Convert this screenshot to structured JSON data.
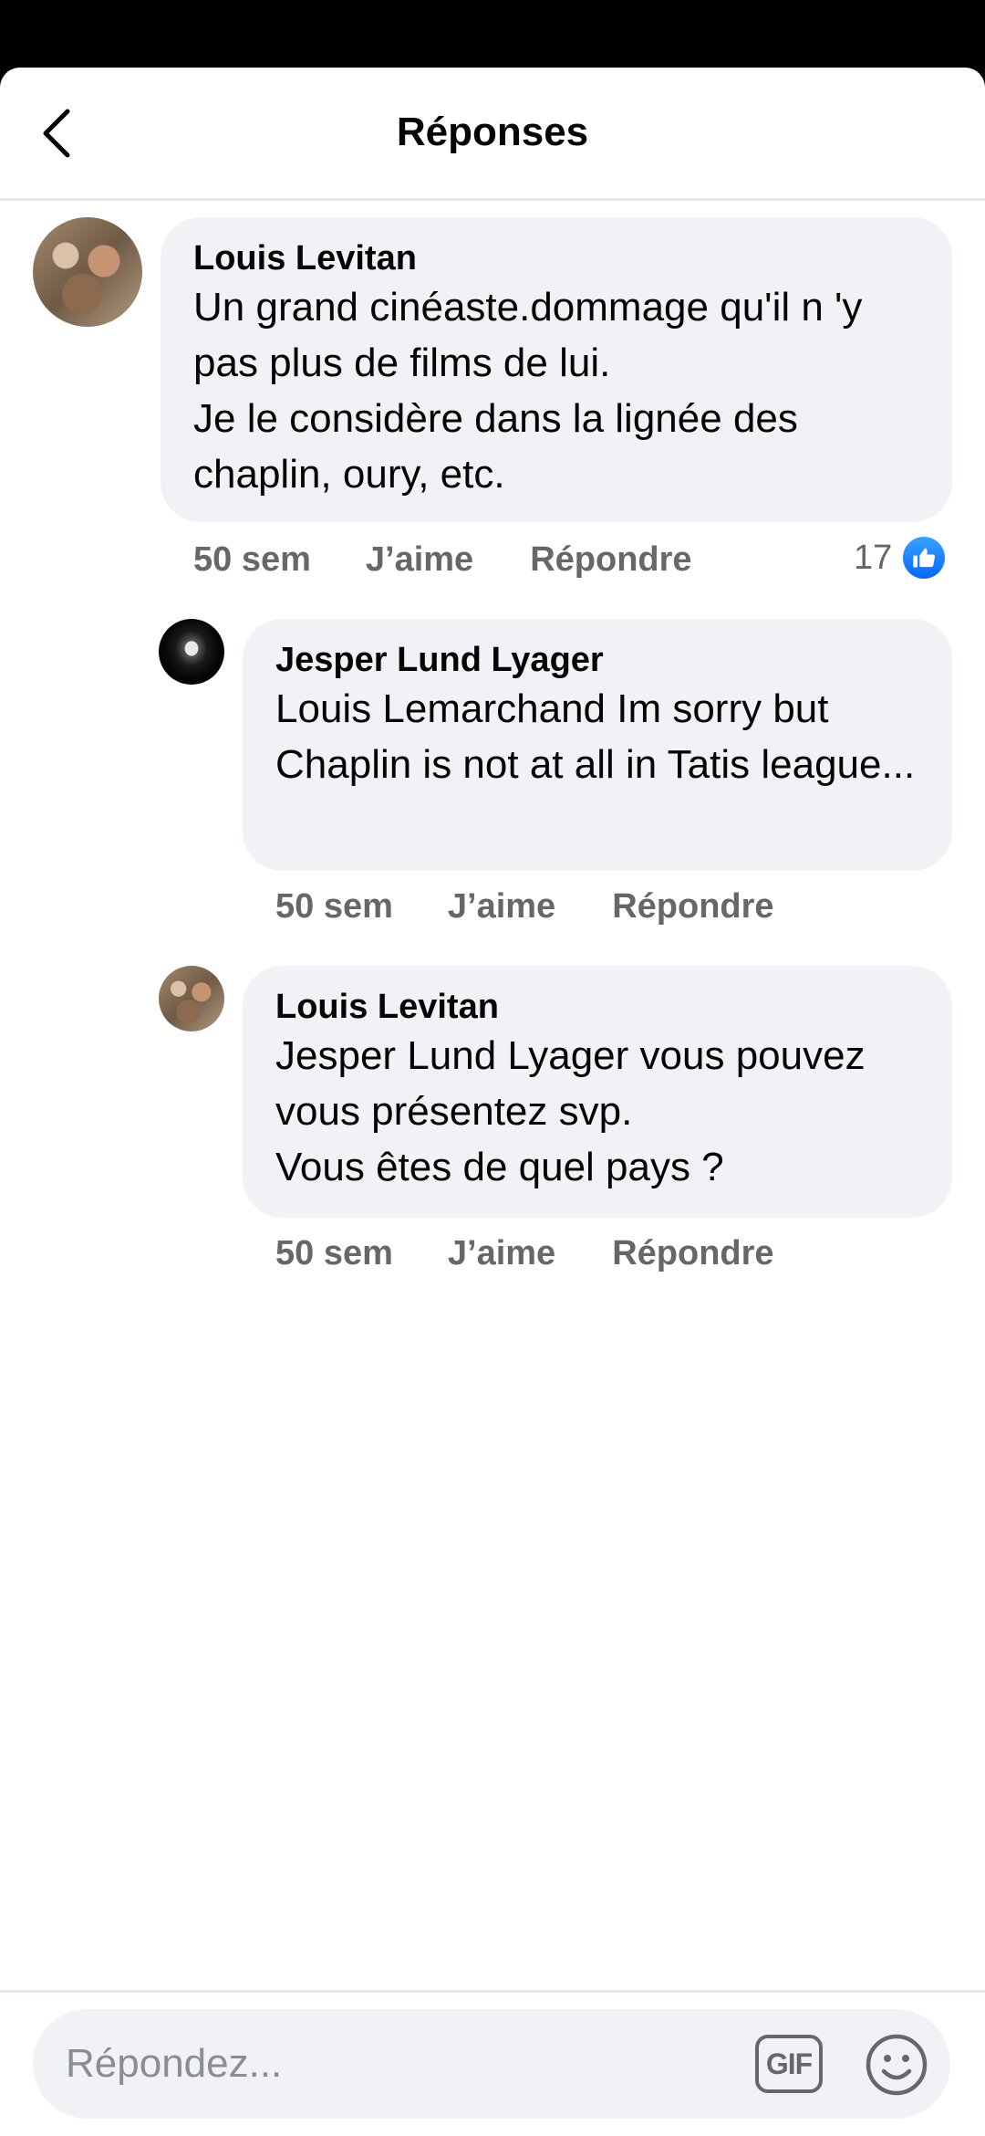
{
  "header": {
    "title": "Réponses"
  },
  "comments": [
    {
      "author": "Louis Levitan",
      "text": "Un grand cinéaste.dommage qu'il n 'y pas plus de films de lui.\nJe le considère dans la lignée des chaplin, oury, etc.",
      "time": "50 sem",
      "like_label": "J’aime",
      "reply_label": "Répondre",
      "reaction_count": "17",
      "reaction_icon": "like-icon"
    },
    {
      "author": "Jesper Lund Lyager",
      "text": "Louis Lemarchand Im sorry but Chaplin is not at all in Tatis league...",
      "time": "50 sem",
      "like_label": "J’aime",
      "reply_label": "Répondre"
    },
    {
      "author": "Louis Levitan",
      "text": "Jesper Lund Lyager vous pouvez vous présentez svp.\nVous êtes de quel pays ?",
      "time": "50 sem",
      "like_label": "J’aime",
      "reply_label": "Répondre"
    }
  ],
  "composer": {
    "placeholder": "Répondez...",
    "gif_label": "GIF",
    "emoji_icon": "smiley-icon"
  },
  "colors": {
    "bubble": "#f0f2f5",
    "secondary_text": "#65676b",
    "like_blue": "#0866ff"
  }
}
